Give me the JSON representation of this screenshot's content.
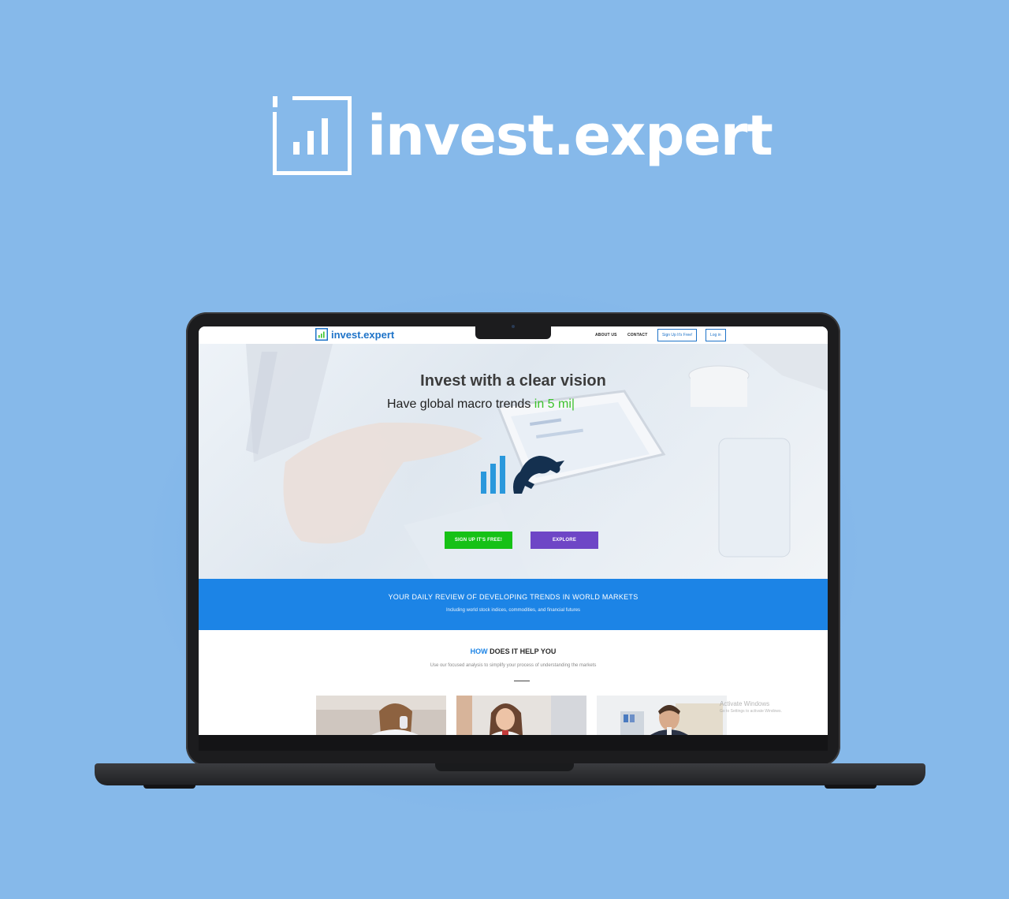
{
  "brand": {
    "name": "invest.expert"
  },
  "site": {
    "logo_text": "invest.expert",
    "nav": {
      "about": "ABOUT US",
      "contact": "CONTACT",
      "signup": "Sign Up It's Free!",
      "login": "Log in"
    },
    "hero": {
      "title": "Invest with a clear vision",
      "subtitle_prefix": "Have global macro trends ",
      "subtitle_accent": "in 5 mi|",
      "signup_button": "SIGN UP IT'S FREE!",
      "explore_button": "EXPLORE"
    },
    "banner": {
      "title": "YOUR DAILY REVIEW OF DEVELOPING TRENDS IN WORLD MARKETS",
      "subtitle": "Including world stock indices, commodities, and financial futures"
    },
    "how": {
      "title_accent": "HOW",
      "title_rest": " DOES IT HELP YOU",
      "subtitle": "Use our focused analysis to simplify your process of understanding the markets"
    },
    "watermark": {
      "line1": "Activate Windows",
      "line2": "Go to Settings to activate Windows."
    }
  },
  "colors": {
    "background": "#86b9ea",
    "brand_blue": "#1e73c8",
    "banner_blue": "#1c84e6",
    "signup_green": "#16c116",
    "explore_purple": "#6e46c6",
    "accent_green": "#3cc22c"
  },
  "icons": {
    "brand": "bar-chart-frame-icon",
    "hero_emblem": "bull-chart-icon"
  }
}
